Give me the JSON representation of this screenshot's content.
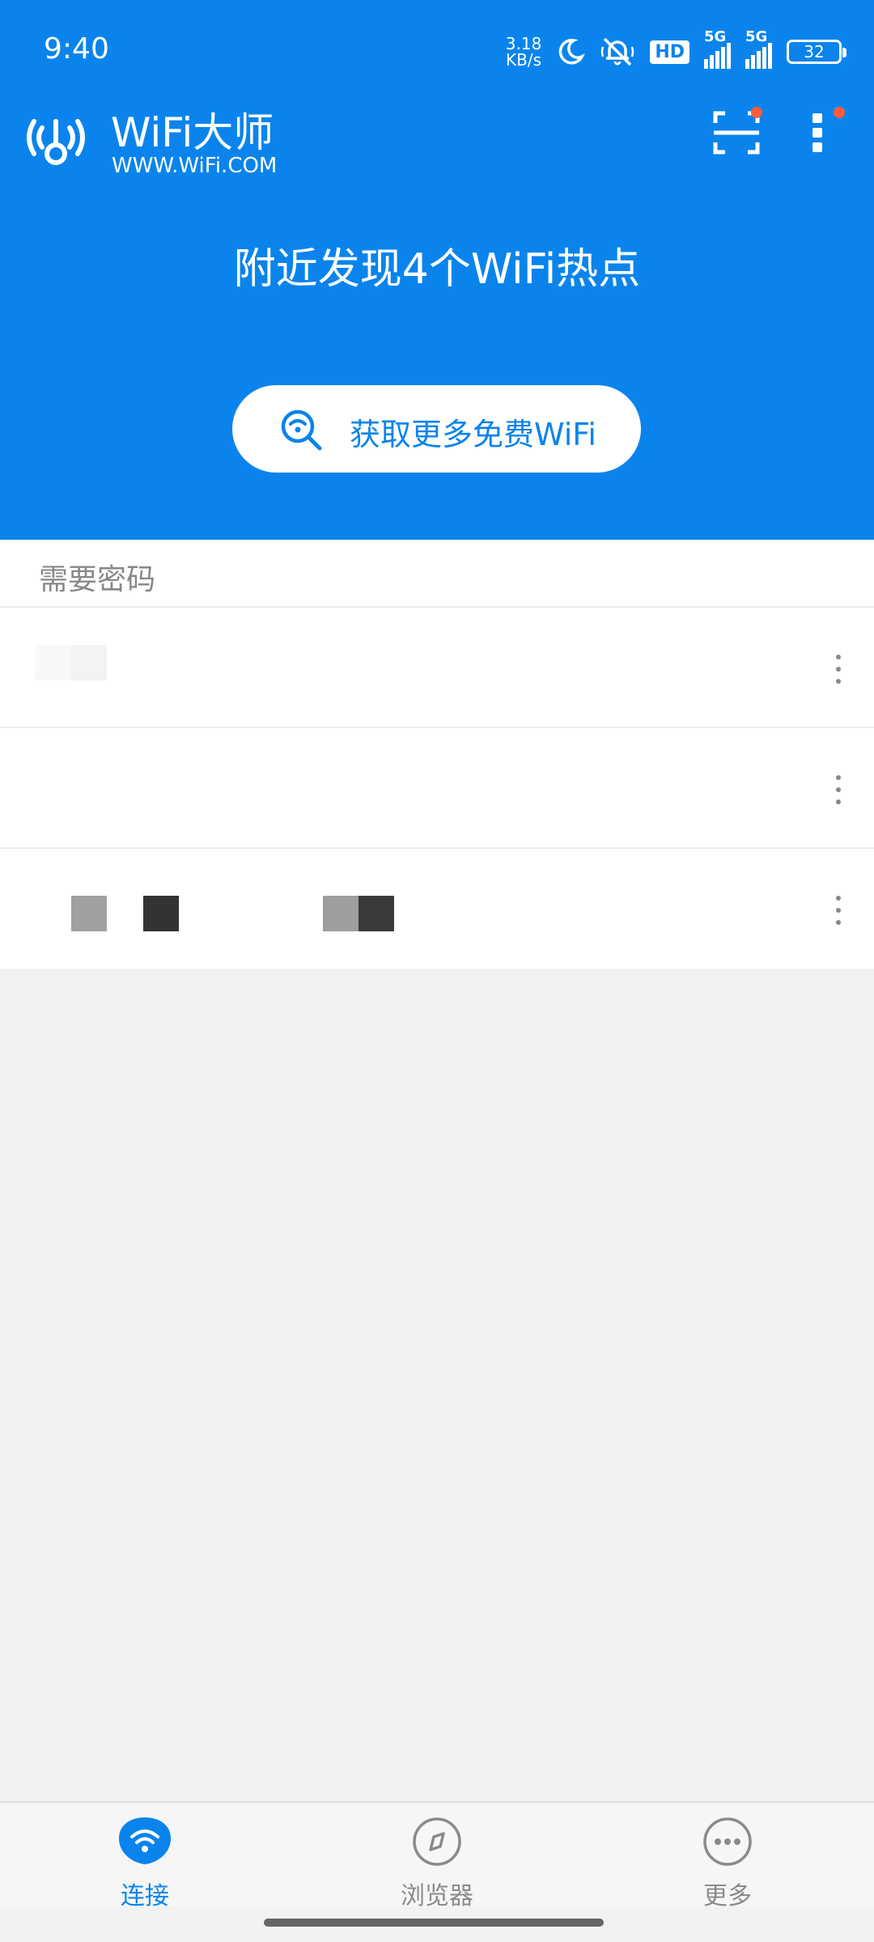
{
  "status_bar": {
    "time": "9:40",
    "net_speed_value": "3.18",
    "net_speed_unit": "KB/s",
    "hd_badge": "HD",
    "signal_1_label": "5G",
    "signal_2_label": "5G",
    "battery_level": "32"
  },
  "header": {
    "app_name": "WiFi大师",
    "app_domain": "WWW.WiFi.COM"
  },
  "hero": {
    "hotspot_message": "附近发现4个WiFi热点",
    "more_wifi_button": "获取更多免费WiFi"
  },
  "wifi_list": {
    "section_title": "需要密码",
    "rows": [
      {
        "name": ""
      },
      {
        "name": ""
      },
      {
        "name": ""
      }
    ]
  },
  "bottom_nav": {
    "items": [
      {
        "label": "连接",
        "icon": "wifi-icon",
        "active": true
      },
      {
        "label": "浏览器",
        "icon": "compass-icon",
        "active": false
      },
      {
        "label": "更多",
        "icon": "more-icon",
        "active": false
      }
    ]
  },
  "colors": {
    "brand_blue": "#0a84ec",
    "badge_red": "#ff5a3c",
    "inactive_gray": "#8a8a8a"
  }
}
